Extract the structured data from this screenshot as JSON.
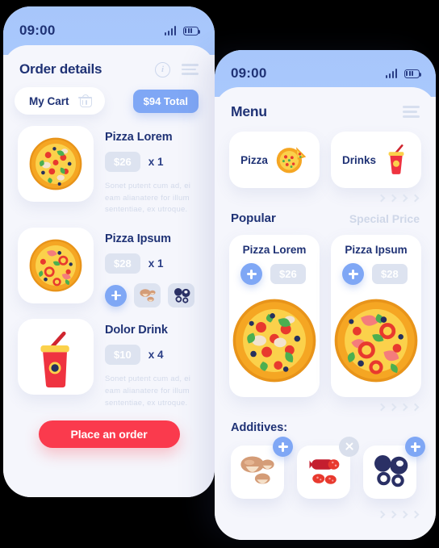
{
  "left_phone": {
    "status": {
      "time": "09:00",
      "signal_icon": "signal-bars-icon",
      "battery_icon": "battery-icon"
    },
    "header": {
      "title": "Order details",
      "info_icon": "info-icon",
      "menu_icon": "hamburger-menu-icon"
    },
    "cart": {
      "label": "My Cart",
      "icon": "shopping-basket-icon",
      "total": "$94 Total"
    },
    "items": [
      {
        "name": "Pizza Lorem",
        "price": "$26",
        "qty": "x 1",
        "image": "pizza-veggie-icon",
        "desc_lines": [
          "Sonet putent cum ad, ei",
          "eam alianatere for illum",
          "sententiae,  ex  utroque."
        ],
        "has_addons": false
      },
      {
        "name": "Pizza Ipsum",
        "price": "$28",
        "qty": "x 1",
        "image": "pizza-pepper-icon",
        "desc_lines": [],
        "has_addons": true,
        "addons": [
          "mushroom-icon",
          "olive-icon"
        ],
        "add_button": "add-addon-button"
      },
      {
        "name": "Dolor Drink",
        "price": "$10",
        "qty": "x 4",
        "image": "soda-cup-icon",
        "desc_lines": [
          "Sonet putent cum ad, ei",
          "eam alianatere for illum",
          "sententiae,  ex  utroque."
        ],
        "has_addons": false
      }
    ],
    "place_order_label": "Place an order"
  },
  "right_phone": {
    "status": {
      "time": "09:00",
      "signal_icon": "signal-bars-icon",
      "battery_icon": "battery-icon"
    },
    "header": {
      "title": "Menu",
      "menu_icon": "hamburger-menu-icon"
    },
    "categories": [
      {
        "label": "Pizza",
        "icon": "pizza-slice-icon"
      },
      {
        "label": "Drinks",
        "icon": "soda-cup-icon"
      }
    ],
    "popular": {
      "title": "Popular",
      "alt_title": "Special Price",
      "products": [
        {
          "name": "Pizza Lorem",
          "price": "$26",
          "image": "pizza-veggie-icon",
          "add_button": "add-to-cart-button"
        },
        {
          "name": "Pizza Ipsum",
          "price": "$28",
          "image": "pizza-pepper-icon",
          "add_button": "add-to-cart-button"
        }
      ]
    },
    "additives": {
      "title": "Additives:",
      "items": [
        {
          "image": "mushroom-icon",
          "badge": "plus",
          "badge_icon": "plus-icon"
        },
        {
          "image": "salami-icon",
          "badge": "close",
          "badge_icon": "close-icon"
        },
        {
          "image": "olive-icon",
          "badge": "plus",
          "badge_icon": "plus-icon"
        }
      ]
    },
    "scroll_hint_icon": "chevron-right-icon"
  },
  "colors": {
    "accent_blue": "#7FA7F5",
    "header_blue": "#A7C6FB",
    "navy": "#1F3275",
    "red": "#FA3A4D",
    "surface": "#F5F6FC",
    "pill_gray": "#DDE3F0"
  }
}
